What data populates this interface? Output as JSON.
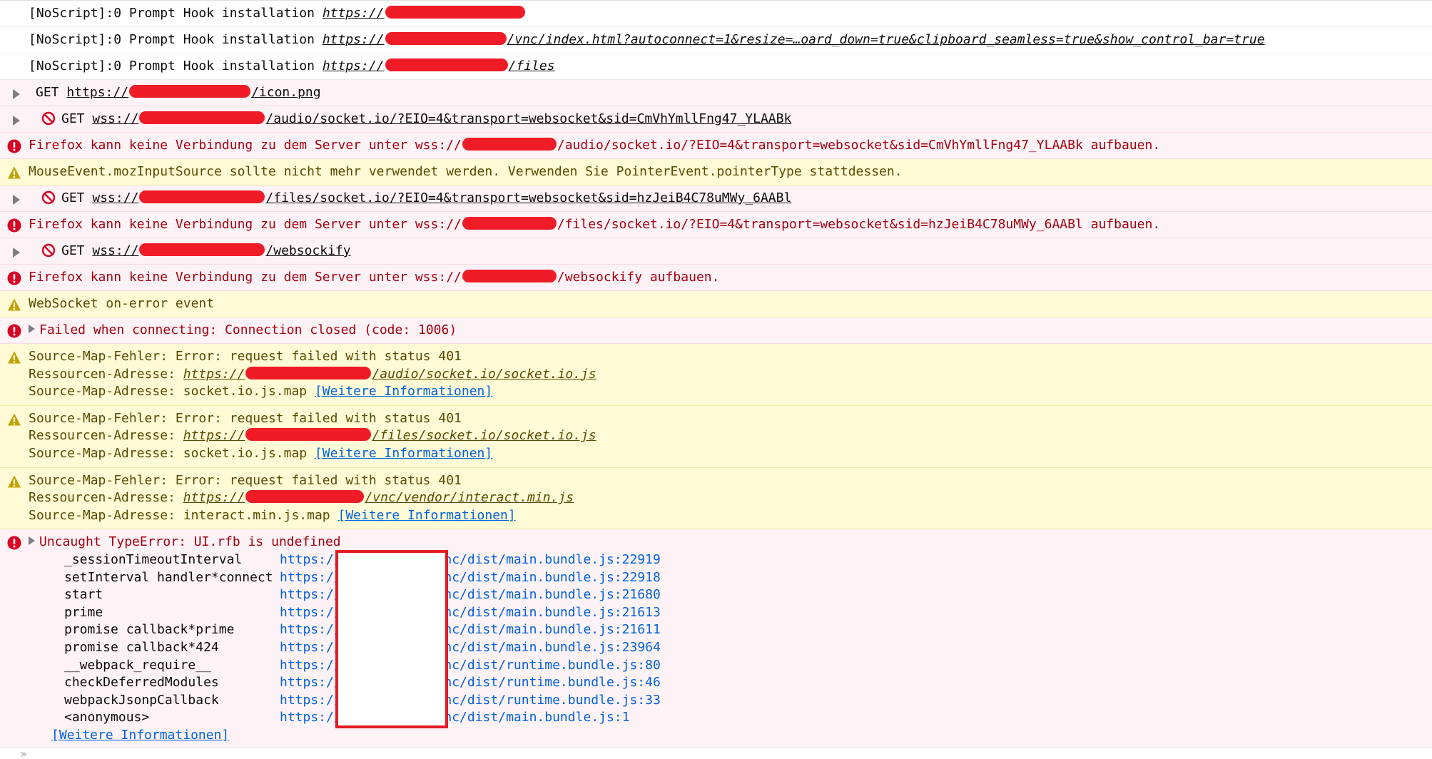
{
  "colors": {
    "error_bg": "#fdf2f5",
    "error_text": "#a4000f",
    "warn_bg": "#fffbd6",
    "warn_text": "#5a4b00",
    "link": "#0060df",
    "redaction": "#ef1c27"
  },
  "icons": {
    "error": "error-icon",
    "warning": "warning-icon",
    "blocked": "blocked-icon",
    "expand": "chevron-right-icon"
  },
  "messages": {
    "m1": {
      "text": "[NoScript]:0 Prompt Hook installation ",
      "url_prefix": "https://",
      "url_suffix": ""
    },
    "m2": {
      "text": "[NoScript]:0 Prompt Hook installation ",
      "url_prefix": "https://",
      "url_suffix": "/vnc/index.html?autoconnect=1&resize=…oard_down=true&clipboard_seamless=true&show_control_bar=true"
    },
    "m3": {
      "text": "[NoScript]:0 Prompt Hook installation ",
      "url_prefix": "https://",
      "url_suffix": "/files"
    },
    "m4": {
      "method": "GET",
      "url_prefix": "https://",
      "url_suffix": "/icon.png"
    },
    "m5": {
      "method": "GET",
      "url_prefix": "wss://",
      "url_suffix": "/audio/socket.io/?EIO=4&transport=websocket&sid=CmVhYmllFng47_YLAABk"
    },
    "m6": {
      "text_pre": "Firefox kann keine Verbindung zu dem Server unter wss://",
      "text_post": "/audio/socket.io/?EIO=4&transport=websocket&sid=CmVhYmllFng47_YLAABk aufbauen."
    },
    "m7": {
      "text": "MouseEvent.mozInputSource sollte nicht mehr verwendet werden. Verwenden Sie PointerEvent.pointerType stattdessen."
    },
    "m8": {
      "method": "GET",
      "url_prefix": "wss://",
      "url_suffix": "/files/socket.io/?EIO=4&transport=websocket&sid=hzJeiB4C78uMWy_6AABl"
    },
    "m9": {
      "text_pre": "Firefox kann keine Verbindung zu dem Server unter wss://",
      "text_post": "/files/socket.io/?EIO=4&transport=websocket&sid=hzJeiB4C78uMWy_6AABl aufbauen."
    },
    "m10": {
      "method": "GET",
      "url_prefix": "wss://",
      "url_suffix": "/websockify"
    },
    "m11": {
      "text_pre": "Firefox kann keine Verbindung zu dem Server unter wss://",
      "text_post": "/websockify aufbauen."
    },
    "m12": {
      "text": "WebSocket on-error event"
    },
    "m13": {
      "text": "Failed when connecting: Connection closed (code: 1006)"
    },
    "m14": {
      "line1": "Source-Map-Fehler: Error: request failed with status 401",
      "res_label": "Ressourcen-Adresse: ",
      "res_prefix": "https://",
      "res_suffix": "/audio/socket.io/socket.io.js",
      "map_label": "Source-Map-Adresse: socket.io.js.map ",
      "more": "[Weitere Informationen]"
    },
    "m15": {
      "line1": "Source-Map-Fehler: Error: request failed with status 401",
      "res_label": "Ressourcen-Adresse: ",
      "res_prefix": "https://",
      "res_suffix": "/files/socket.io/socket.io.js",
      "map_label": "Source-Map-Adresse: socket.io.js.map ",
      "more": "[Weitere Informationen]"
    },
    "m16": {
      "line1": "Source-Map-Fehler: Error: request failed with status 401",
      "res_label": "Ressourcen-Adresse: ",
      "res_prefix": "https://",
      "res_suffix": "/vnc/vendor/interact.min.js",
      "map_label": "Source-Map-Adresse: interact.min.js.map ",
      "more": "[Weitere Informationen]"
    },
    "m17": {
      "text": "Uncaught TypeError: UI.rfb is undefined",
      "more": "[Weitere Informationen]",
      "frames": [
        {
          "name": "_sessionTimeoutInterval",
          "prefix": "https://",
          "loc": "/vnc/dist/main.bundle.js:22919"
        },
        {
          "name": "setInterval handler*connect",
          "prefix": "https://",
          "loc": "/vnc/dist/main.bundle.js:22918"
        },
        {
          "name": "start",
          "prefix": "https://",
          "loc": "/vnc/dist/main.bundle.js:21680"
        },
        {
          "name": "prime",
          "prefix": "https://",
          "loc": "/vnc/dist/main.bundle.js:21613"
        },
        {
          "name": "promise callback*prime",
          "prefix": "https://",
          "loc": "/vnc/dist/main.bundle.js:21611"
        },
        {
          "name": "promise callback*424",
          "prefix": "https://",
          "loc": "/vnc/dist/main.bundle.js:23964"
        },
        {
          "name": "__webpack_require__",
          "prefix": "https://",
          "loc": "/vnc/dist/runtime.bundle.js:80"
        },
        {
          "name": "checkDeferredModules",
          "prefix": "https://",
          "loc": "/vnc/dist/runtime.bundle.js:46"
        },
        {
          "name": "webpackJsonpCallback",
          "prefix": "https://",
          "loc": "/vnc/dist/runtime.bundle.js:33"
        },
        {
          "name": "<anonymous>",
          "prefix": "https://",
          "loc": "/vnc/dist/main.bundle.js:1"
        }
      ]
    }
  },
  "input": {
    "prompt": "»"
  }
}
